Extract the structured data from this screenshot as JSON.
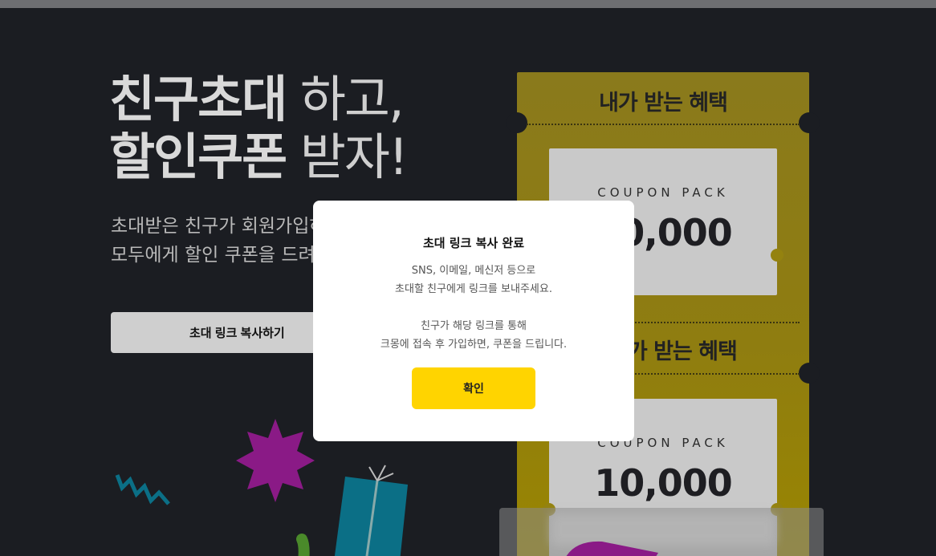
{
  "hero": {
    "title_bold_1": "친구초대",
    "title_light_1": " 하고,",
    "title_bold_2": "할인쿠폰",
    "title_light_2": " 받자!",
    "desc_line_1": "초대받은 친구가 회원가입하면",
    "desc_line_2": "모두에게 할인 쿠폰을 드려요",
    "copy_button_label": "초대 링크 복사하기"
  },
  "ticket": {
    "my_benefit_heading": "내가 받는 혜택",
    "friend_benefit_heading": "친구가 받는 혜택",
    "cards": [
      {
        "pack_label": "COUPON PACK",
        "amount": "10,000"
      },
      {
        "pack_label": "COUPON PACK",
        "amount": "10,000"
      }
    ]
  },
  "modal": {
    "title": "초대 링크 복사 완료",
    "line_1": "SNS, 이메일, 메신저 등으로",
    "line_2": "초대할 친구에게 링크를 보내주세요.",
    "line_3": "친구가 해당 링크를 통해",
    "line_4": "크몽에 접속 후 가입하면, 쿠폰을 드립니다.",
    "confirm_label": "확인"
  },
  "colors": {
    "background": "#1b1d22",
    "accent_yellow": "#ffd400",
    "ticket_gold": "#8f7d10",
    "confetti_purple": "#8a1a86",
    "gift_teal": "#0b6f86"
  },
  "icons": [
    "star-burst-decoration",
    "zigzag-decoration",
    "gift-box-decoration",
    "green-squiggle-decoration",
    "purple-ribbon-decoration"
  ]
}
